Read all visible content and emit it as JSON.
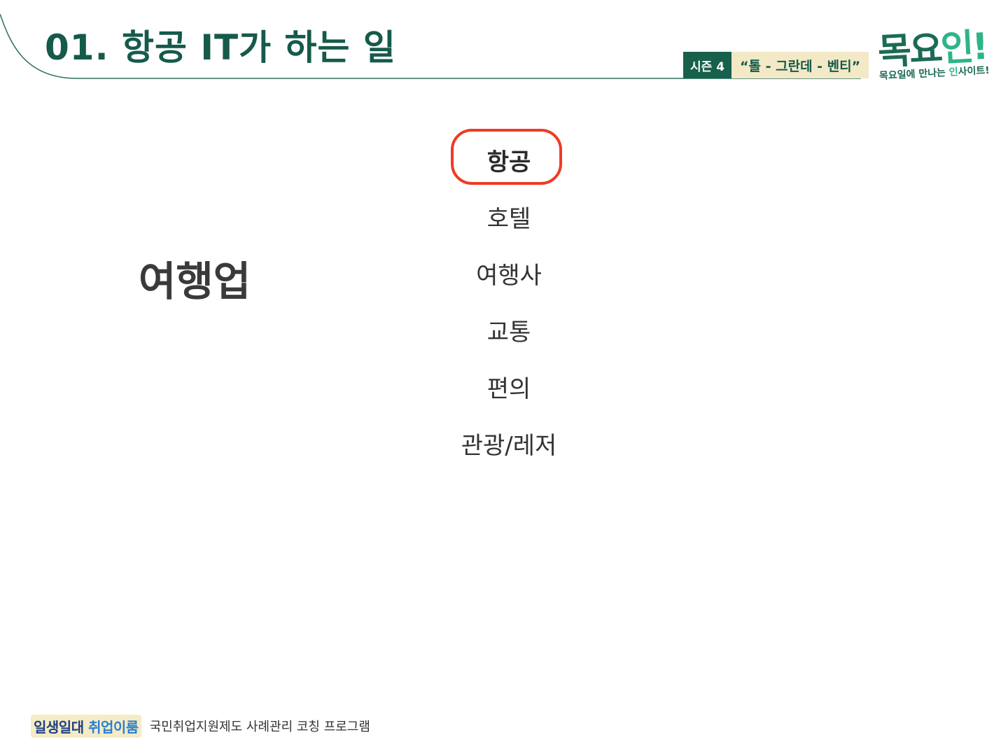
{
  "header": {
    "title": "01. 항공 IT가 하는 일",
    "season_label": "시즌 4",
    "season_tagline": "“톨 - 그란데 - 벤티”"
  },
  "logo": {
    "main_part1": "목요",
    "main_part2": "인!",
    "sub_part1": "목요일에 만나는 ",
    "sub_part2": "인",
    "sub_part3": "사이트!"
  },
  "main": {
    "category": "여행업",
    "items": [
      {
        "label": "항공",
        "highlighted": true
      },
      {
        "label": "호텔",
        "highlighted": false
      },
      {
        "label": "여행사",
        "highlighted": false
      },
      {
        "label": "교통",
        "highlighted": false
      },
      {
        "label": "편의",
        "highlighted": false
      },
      {
        "label": "관광/레저",
        "highlighted": false
      }
    ]
  },
  "footer": {
    "brand_part1": "일생일대 ",
    "brand_part2": "취업이룸",
    "text": "국민취업지원제도 사례관리 코칭 프로그램"
  },
  "colors": {
    "title": "#155a4a",
    "season_bg": "#17604c",
    "tagline_bg": "#f3e9c6",
    "logo_green": "#1c6a56",
    "logo_accent": "#2fb48a",
    "highlight_ring": "#ef3b24",
    "category_text": "#3a3a3a",
    "footer_brand": "#1f3f83"
  }
}
